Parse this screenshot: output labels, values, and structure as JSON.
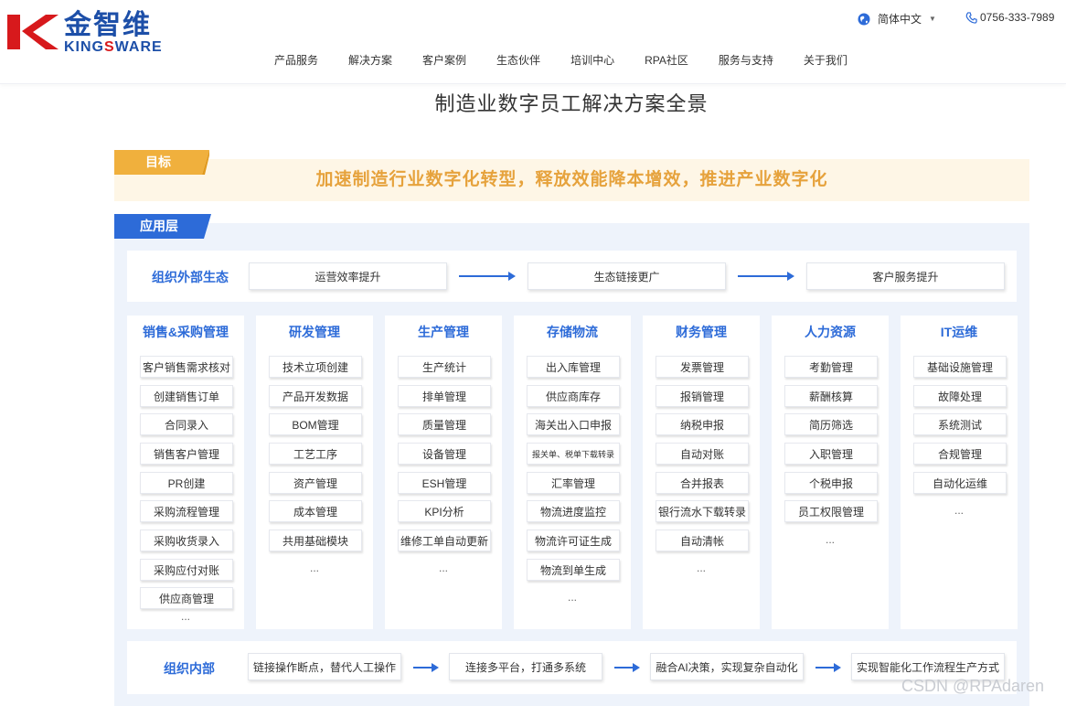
{
  "header": {
    "logo_cn": "金智维",
    "logo_en_part1": "KING",
    "logo_en_part2": "S",
    "logo_en_part3": "WARE",
    "language": "简体中文",
    "phone": "0756-333-7989",
    "nav": [
      "产品服务",
      "解决方案",
      "客户案例",
      "生态伙伴",
      "培训中心",
      "RPA社区",
      "服务与支持",
      "关于我们"
    ]
  },
  "page_title": "制造业数字员工解决方案全景",
  "goal": {
    "tag": "目标",
    "text": "加速制造行业数字化转型，释放效能降本增效，推进产业数字化"
  },
  "app_layer": {
    "tag": "应用层",
    "external": {
      "label": "组织外部生态",
      "steps": [
        "运营效率提升",
        "生态链接更广",
        "客户服务提升"
      ]
    },
    "columns": [
      {
        "title": "销售&采购管理",
        "items": [
          "客户销售需求核对",
          "创建销售订单",
          "合同录入",
          "销售客户管理",
          "PR创建",
          "采购流程管理",
          "采购收货录入",
          "采购应付对账",
          "供应商管理"
        ],
        "more": "..."
      },
      {
        "title": "研发管理",
        "items": [
          "技术立项创建",
          "产品开发数据",
          "BOM管理",
          "工艺工序",
          "资产管理",
          "成本管理",
          "共用基础模块"
        ],
        "more": "..."
      },
      {
        "title": "生产管理",
        "items": [
          "生产统计",
          "排单管理",
          "质量管理",
          "设备管理",
          "ESH管理",
          "KPI分析",
          "维修工单自动更新"
        ],
        "more": "..."
      },
      {
        "title": "存储物流",
        "items": [
          "出入库管理",
          "供应商库存",
          "海关出入口申报",
          "报关单、税单下载转录",
          "汇率管理",
          "物流进度监控",
          "物流许可证生成",
          "物流到单生成"
        ],
        "more": "..."
      },
      {
        "title": "财务管理",
        "items": [
          "发票管理",
          "报销管理",
          "纳税申报",
          "自动对账",
          "合并报表",
          "银行流水下载转录",
          "自动清帐"
        ],
        "more": "..."
      },
      {
        "title": "人力资源",
        "items": [
          "考勤管理",
          "薪酬核算",
          "简历筛选",
          "入职管理",
          "个税申报",
          "员工权限管理"
        ],
        "more": "..."
      },
      {
        "title": "IT运维",
        "items": [
          "基础设施管理",
          "故障处理",
          "系统测试",
          "合规管理",
          "自动化运维"
        ],
        "more": "..."
      }
    ],
    "internal": {
      "label": "组织内部",
      "steps": [
        "链接操作断点，替代人工操作",
        "连接多平台，打通多系统",
        "融合AI决策，实现复杂自动化",
        "实现智能化工作流程生产方式"
      ]
    }
  },
  "watermark": "CSDN @RPAdaren",
  "colors": {
    "brand_blue": "#2d6bd8",
    "goal_orange": "#e6a23c",
    "logo_red": "#d7191c"
  },
  "icons": [
    "globe-icon",
    "phone-icon",
    "caret-down-icon",
    "arrow-right-icon"
  ]
}
